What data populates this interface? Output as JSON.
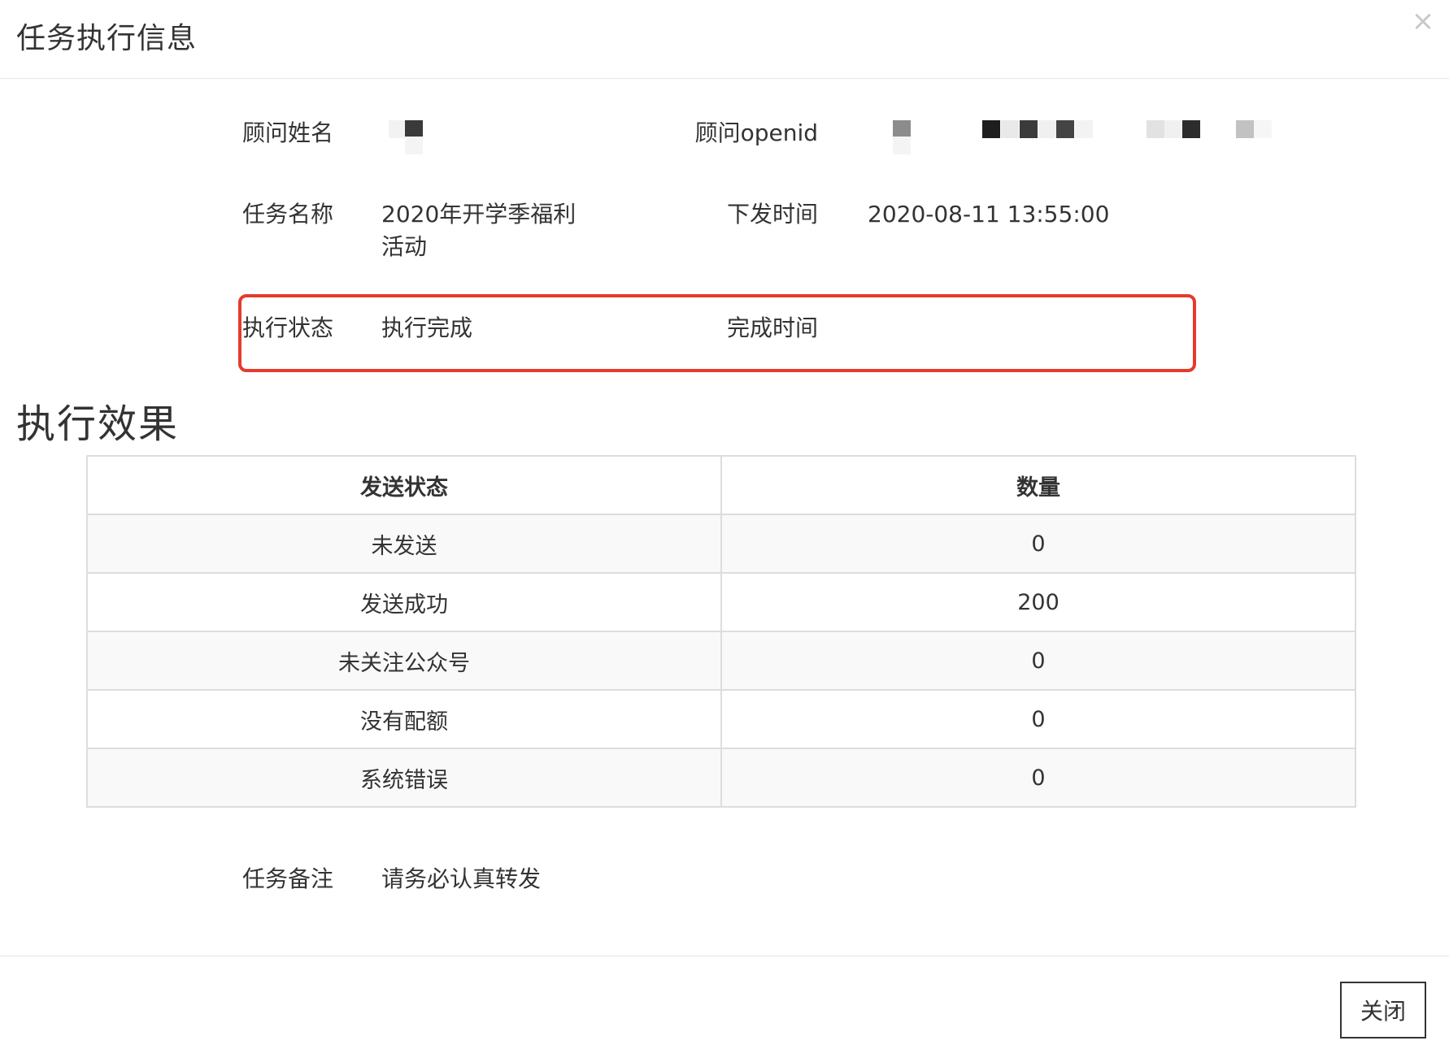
{
  "modal": {
    "title": "任务执行信息",
    "close_icon_glyph": "×"
  },
  "info": {
    "advisor_name_label": "顾问姓名",
    "advisor_openid_label": "顾问openid",
    "task_name_label": "任务名称",
    "task_name_line1": "2020年开学季福利",
    "task_name_line2": "活动",
    "dispatch_time_label": "下发时间",
    "dispatch_time_value": "2020-08-11 13:55:00",
    "exec_status_label": "执行状态",
    "exec_status_value": "执行完成",
    "finish_time_label": "完成时间",
    "finish_time_value": ""
  },
  "effect": {
    "section_title": "执行效果",
    "columns": [
      "发送状态",
      "数量"
    ],
    "rows": [
      {
        "status": "未发送",
        "count": "0"
      },
      {
        "status": "发送成功",
        "count": "200"
      },
      {
        "status": "未关注公众号",
        "count": "0"
      },
      {
        "status": "没有配额",
        "count": "0"
      },
      {
        "status": "系统错误",
        "count": "0"
      }
    ]
  },
  "remark": {
    "label": "任务备注",
    "value": "请务必认真转发"
  },
  "footer": {
    "close_label": "关闭"
  },
  "colors": {
    "highlight_border": "#e53b2c",
    "table_border": "#dddddd",
    "striped_row": "#f9f9f9"
  }
}
